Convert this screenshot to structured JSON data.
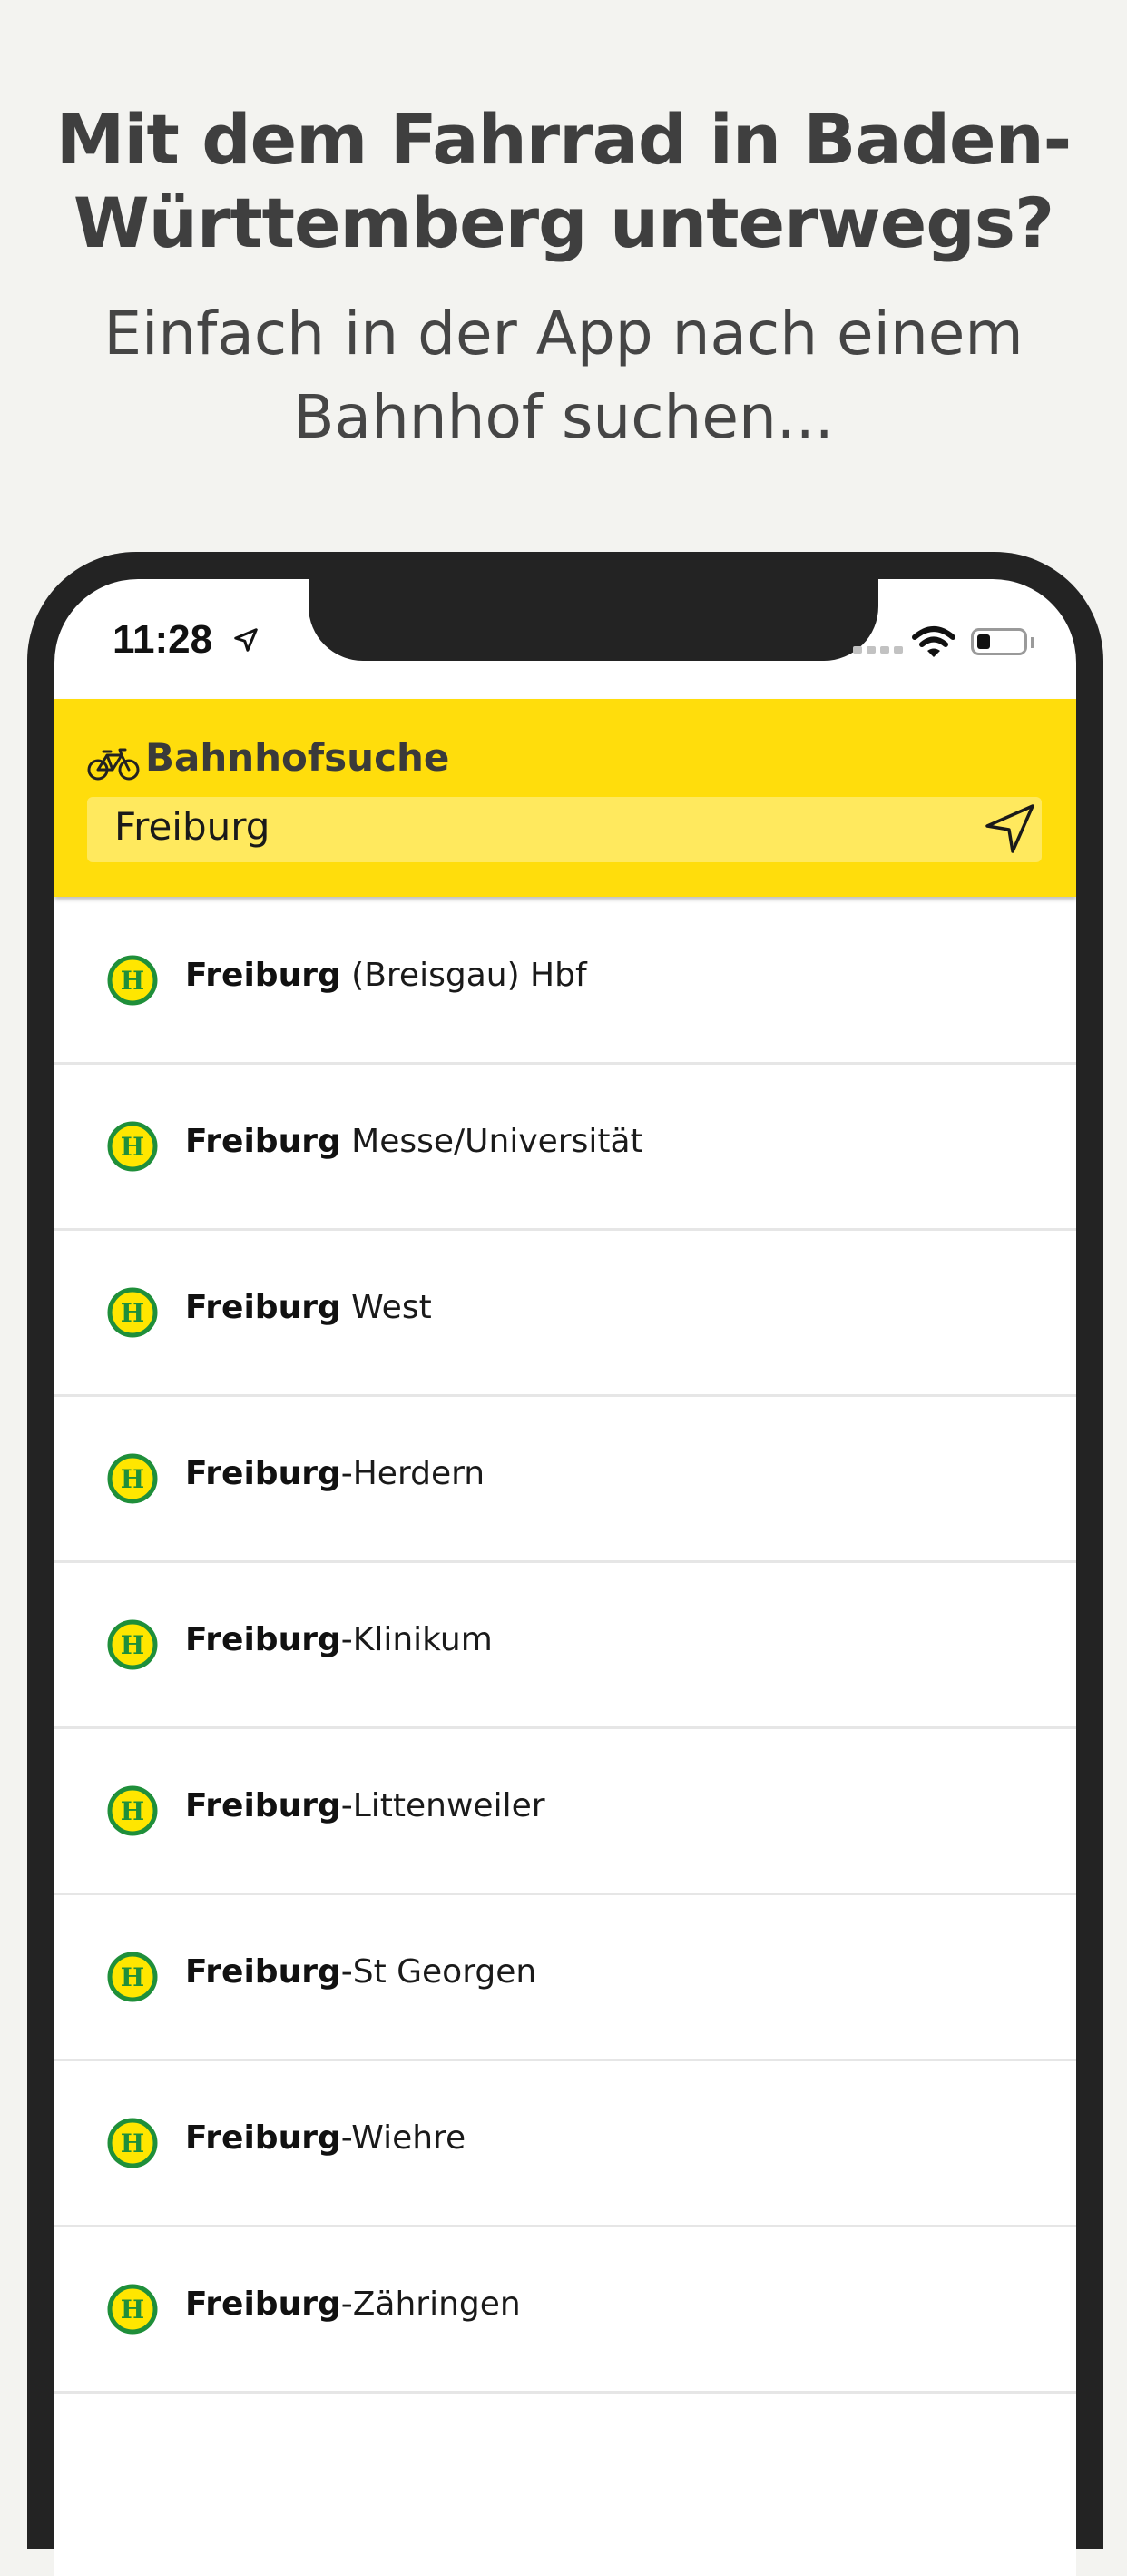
{
  "promo": {
    "headline_line1": "Mit dem Fahrrad in Baden-",
    "headline_line2": "Württemberg unterwegs?",
    "subline_line1": "Einfach in der App nach einem",
    "subline_line2": "Bahnhof suchen..."
  },
  "status_bar": {
    "time": "11:28",
    "location_icon": "location-arrow-icon",
    "wifi_icon": "wifi-icon",
    "battery_icon": "battery-icon"
  },
  "header": {
    "icon": "bicycle-icon",
    "title": "Bahnhofsuche",
    "background_color": "#ffdd0c"
  },
  "search": {
    "value": "Freiburg",
    "locate_icon": "navigation-arrow-icon"
  },
  "results": [
    {
      "bold": "Freiburg",
      "rest": " (Breisgau) Hbf"
    },
    {
      "bold": "Freiburg",
      "rest": " Messe/Universität"
    },
    {
      "bold": "Freiburg",
      "rest": " West"
    },
    {
      "bold": "Freiburg",
      "rest": "-Herdern"
    },
    {
      "bold": "Freiburg",
      "rest": "-Klinikum"
    },
    {
      "bold": "Freiburg",
      "rest": "-Littenweiler"
    },
    {
      "bold": "Freiburg",
      "rest": "-St Georgen"
    },
    {
      "bold": "Freiburg",
      "rest": "-Wiehre"
    },
    {
      "bold": "Freiburg",
      "rest": "-Zähringen"
    }
  ],
  "stop_badge": {
    "icon": "bus-stop-h-icon",
    "letter": "H",
    "ring_color": "#1f8f3a",
    "fill_color": "#ffe600"
  }
}
